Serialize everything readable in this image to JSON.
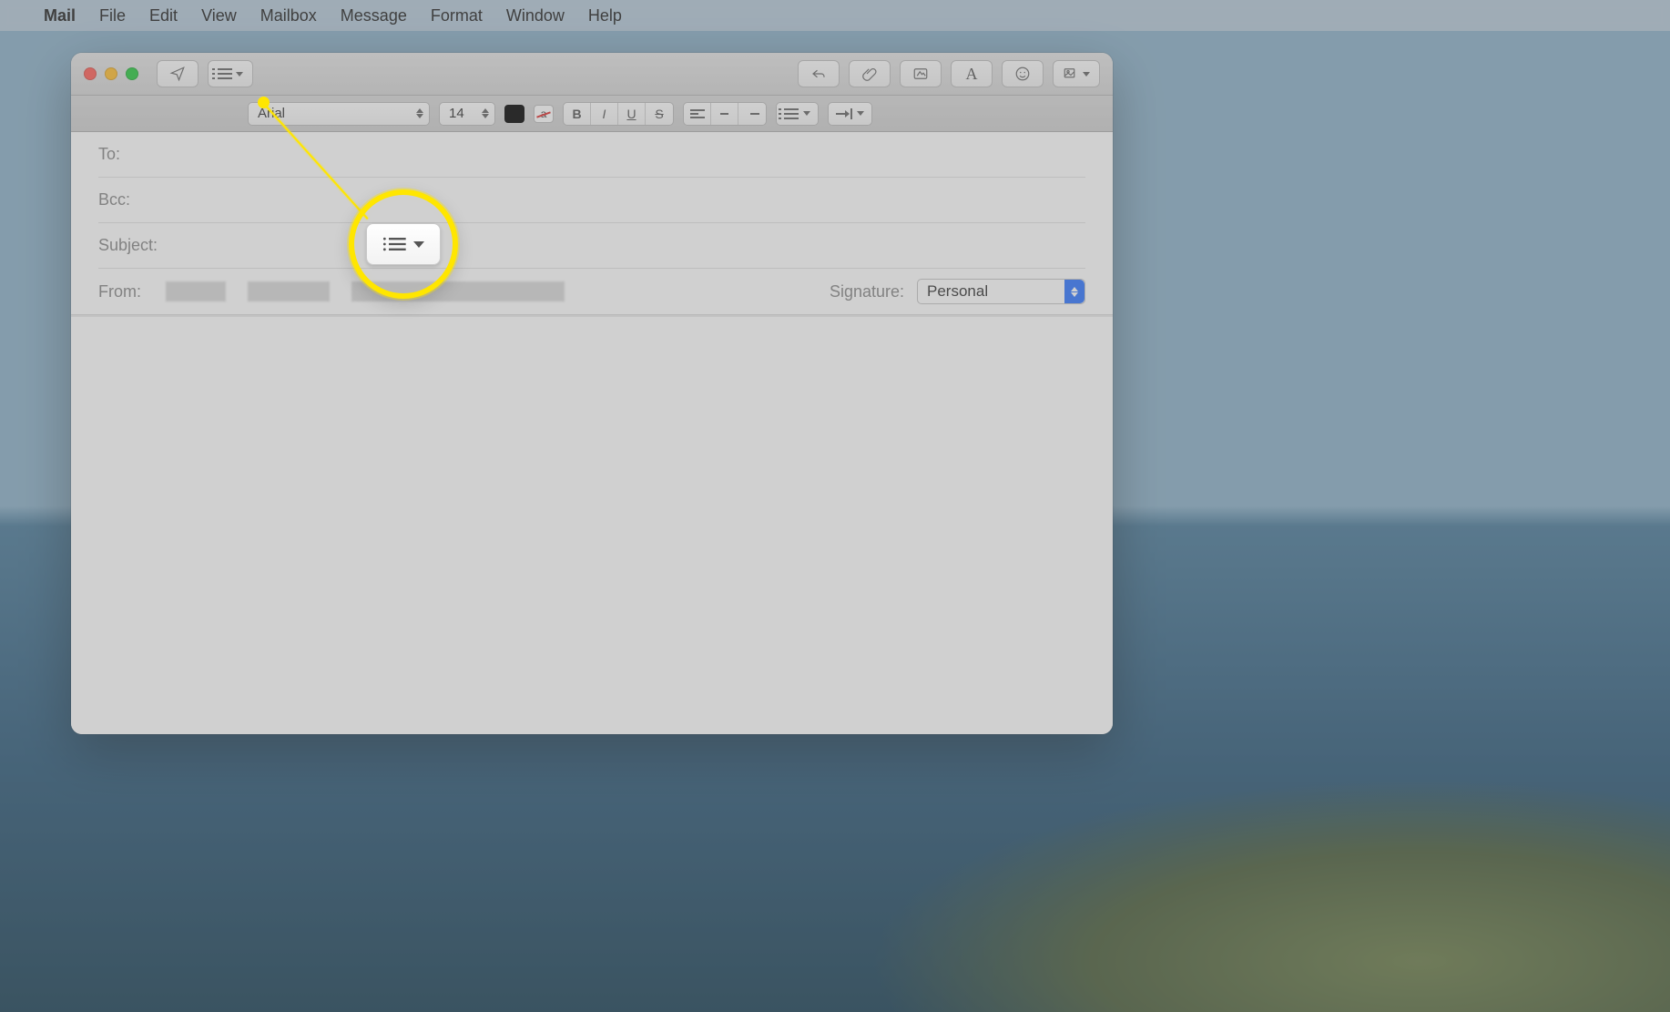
{
  "menubar": {
    "apple": "",
    "app": "Mail",
    "items": [
      "File",
      "Edit",
      "View",
      "Mailbox",
      "Message",
      "Format",
      "Window",
      "Help"
    ]
  },
  "toolbar": {
    "send_icon": "paper-plane",
    "header_fields_icon": "list-chevron",
    "reply_icon": "reply-arrow",
    "attach_icon": "paperclip",
    "markup_icon": "markup",
    "format_icon": "A",
    "emoji_icon": "smiley",
    "photo_icon": "photo-chevron"
  },
  "format": {
    "font": "Arial",
    "size": "14",
    "text_color": "#000000",
    "bg_color": "none",
    "bold": "B",
    "italic": "I",
    "underline": "U",
    "strike": "S"
  },
  "headers": {
    "to_label": "To:",
    "bcc_label": "Bcc:",
    "subject_label": "Subject:",
    "from_label": "From:",
    "to_value": "",
    "bcc_value": "",
    "subject_value": "",
    "signature_label": "Signature:",
    "signature_value": "Personal"
  },
  "callout": {
    "highlight_target": "header-fields-button"
  }
}
